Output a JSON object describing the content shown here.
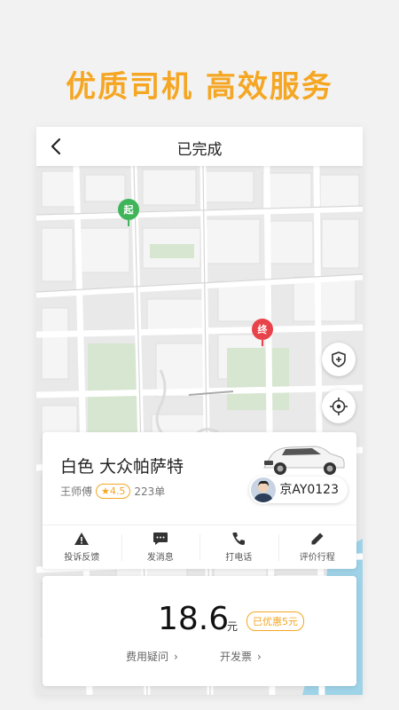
{
  "headline": "优质司机 高效服务",
  "nav": {
    "title": "已完成",
    "back_icon": "back-arrow-icon"
  },
  "map": {
    "start_label": "起",
    "end_label": "终",
    "start_color": "#3fb55a",
    "end_color": "#e8424a",
    "buttons": [
      "shield-icon",
      "locate-icon"
    ]
  },
  "driver_card": {
    "car": "白色 大众帕萨特",
    "driver": "王师傅",
    "rating": "★4.5",
    "orders": "223单",
    "plate": "京AY0123",
    "actions": [
      {
        "label": "投诉反馈",
        "icon": "warning-icon"
      },
      {
        "label": "发消息",
        "icon": "message-icon"
      },
      {
        "label": "打电话",
        "icon": "phone-icon"
      },
      {
        "label": "评价行程",
        "icon": "pencil-icon"
      }
    ]
  },
  "fare": {
    "amount": "18.6",
    "unit": "元",
    "discount": "已优惠5元",
    "links": [
      {
        "label": "费用疑问",
        "chevron": "›"
      },
      {
        "label": "开发票",
        "chevron": "›"
      }
    ]
  },
  "colors": {
    "accent": "#f5a623",
    "map_bg": "#e9e9e9",
    "park": "#d7e6d0",
    "water": "#9fd3e8"
  }
}
